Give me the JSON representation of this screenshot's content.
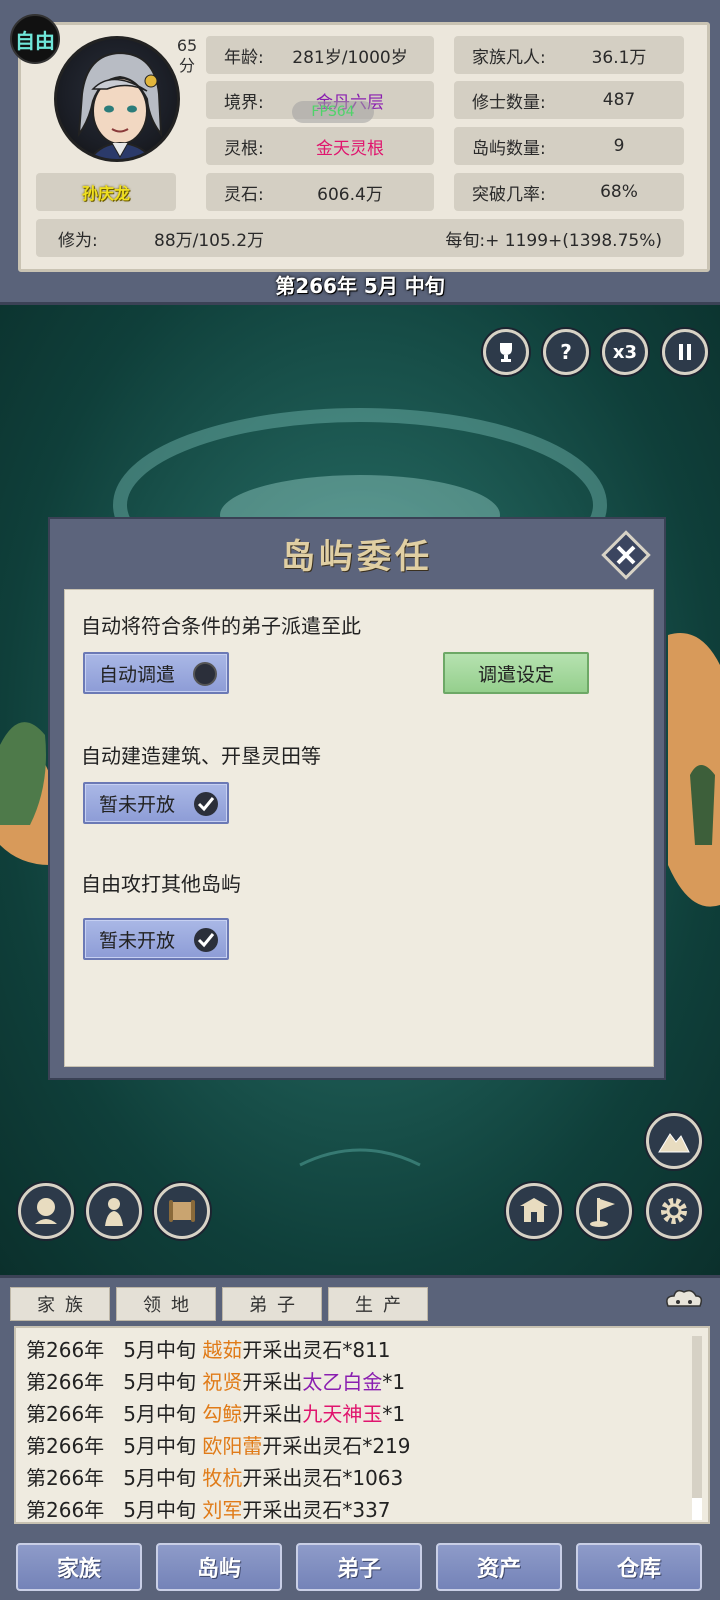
{
  "header": {
    "free_badge": "自由",
    "score_value": "65",
    "score_unit": "分",
    "character_name": "孙庆龙",
    "stats": {
      "age": {
        "label": "年龄:",
        "value": "281岁/1000岁"
      },
      "realm": {
        "label": "境界:",
        "value": "金丹六层",
        "overlay": "FPS64"
      },
      "spirit_root": {
        "label": "灵根:",
        "value": "金天灵根"
      },
      "spirit_stone": {
        "label": "灵石:",
        "value": "606.4万"
      },
      "mortals": {
        "label": "家族凡人:",
        "value": "36.1万"
      },
      "cultivators": {
        "label": "修士数量:",
        "value": "487"
      },
      "islands": {
        "label": "岛屿数量:",
        "value": "9"
      },
      "breakthrough": {
        "label": "突破几率:",
        "value": "68%"
      }
    },
    "cultivation": {
      "label": "修为:",
      "value": "88万/105.2万",
      "per_period": "每旬:+ 1199+(1398.75%)"
    },
    "date": "第266年 5月 中旬"
  },
  "top_controls": {
    "speed_label": "x3"
  },
  "dialog": {
    "title": "岛屿委任",
    "section1_text": "自动将符合条件的弟子派遣至此",
    "auto_dispatch_label": "自动调遣",
    "dispatch_settings_label": "调遣设定",
    "section2_text": "自动建造建筑、开垦灵田等",
    "section2_toggle_label": "暂未开放",
    "section3_text": "自由攻打其他岛屿",
    "section3_toggle_label": "暂未开放"
  },
  "log_tabs": [
    "家族",
    "领地",
    "弟子",
    "生产"
  ],
  "log_entries": [
    {
      "date": "第266年",
      "period": "5月中旬",
      "name": "越茹",
      "action": "开采出",
      "item": "灵石",
      "qty": "*811",
      "item_color": "plain"
    },
    {
      "date": "第266年",
      "period": "5月中旬",
      "name": "祝贤",
      "action": "开采出",
      "item": "太乙白金",
      "qty": "*1",
      "item_color": "purple"
    },
    {
      "date": "第266年",
      "period": "5月中旬",
      "name": "勾鲸",
      "action": "开采出",
      "item": "九天神玉",
      "qty": "*1",
      "item_color": "red"
    },
    {
      "date": "第266年",
      "period": "5月中旬",
      "name": "欧阳蕾",
      "action": "开采出",
      "item": "灵石",
      "qty": "*219",
      "item_color": "plain"
    },
    {
      "date": "第266年",
      "period": "5月中旬",
      "name": "牧杭",
      "action": "开采出",
      "item": "灵石",
      "qty": "*1063",
      "item_color": "plain"
    },
    {
      "date": "第266年",
      "period": "5月中旬",
      "name": "刘军",
      "action": "开采出",
      "item": "灵石",
      "qty": "*337",
      "item_color": "plain"
    }
  ],
  "bottom_nav": [
    "家族",
    "岛屿",
    "弟子",
    "资产",
    "仓库"
  ],
  "colors": {
    "name_orange": "#e07b18",
    "purple": "#8a1eb0",
    "pink": "#e0156e",
    "panel_bg": "#efebe0",
    "frame": "#5a637a"
  }
}
